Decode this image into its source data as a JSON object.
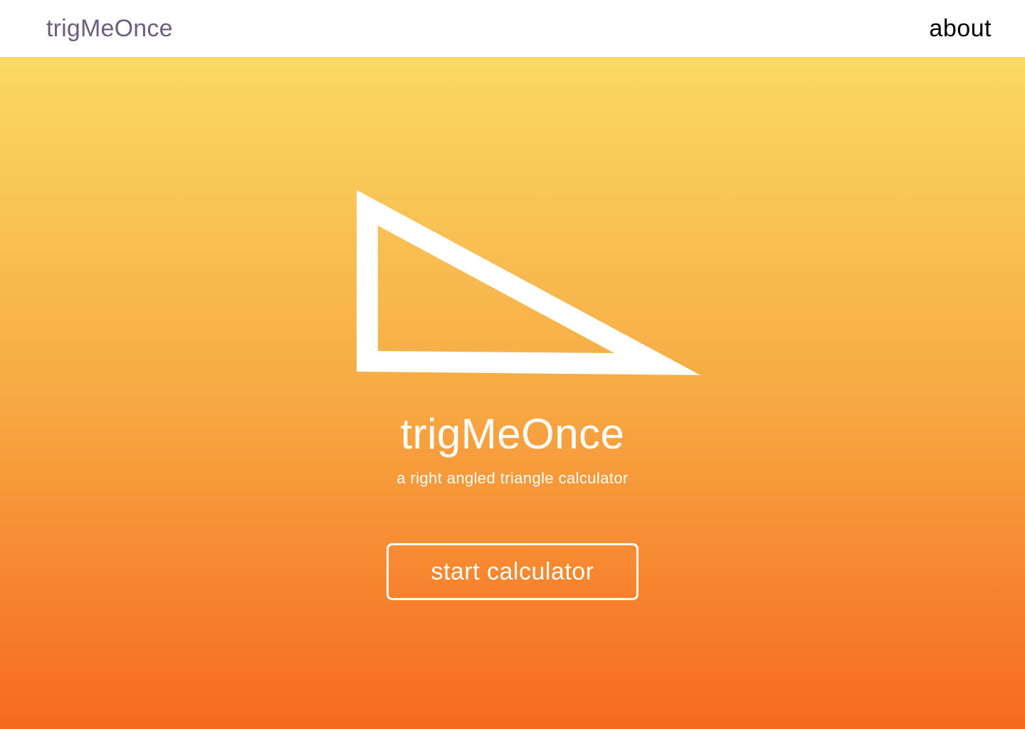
{
  "nav": {
    "brand": "trigMeOnce",
    "about": "about"
  },
  "hero": {
    "icon": "right-triangle-icon",
    "title": "trigMeOnce",
    "subtitle": "a right angled triangle calculator",
    "start_button": "start calculator"
  },
  "colors": {
    "brand_text": "#6e5f80",
    "gradient_top": "#fad964",
    "gradient_mid": "#f7aa45",
    "gradient_bottom": "#f76a1c",
    "hero_foreground": "#ffffff"
  }
}
